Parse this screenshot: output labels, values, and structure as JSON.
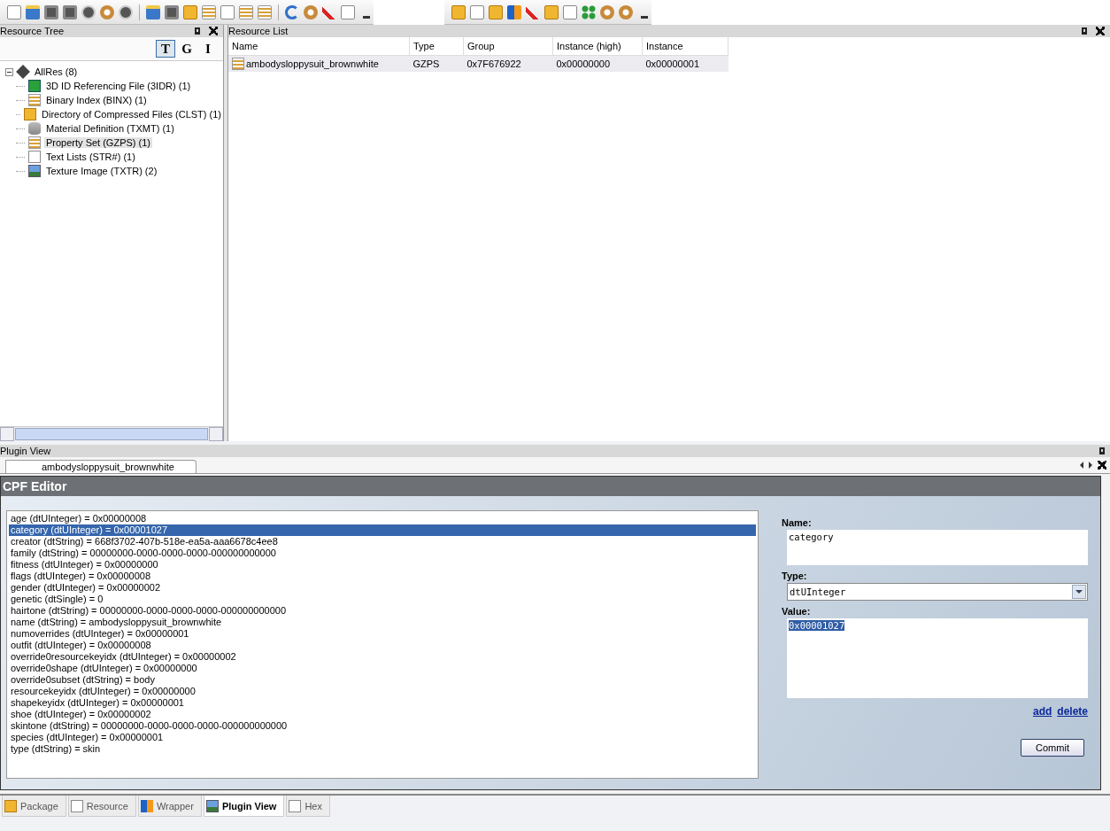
{
  "resource_tree": {
    "title": "Resource Tree",
    "view_toggles": [
      {
        "label": "T",
        "selected": true
      },
      {
        "label": "G",
        "selected": false
      },
      {
        "label": "I",
        "selected": false
      }
    ],
    "root": {
      "label": "AllRes (8)",
      "expanded": true,
      "children": [
        {
          "label": "3D ID Referencing File (3IDR) (1)",
          "selected": false
        },
        {
          "label": "Binary Index (BINX) (1)",
          "selected": false
        },
        {
          "label": "Directory of Compressed Files (CLST) (1)",
          "selected": false
        },
        {
          "label": "Material Definition (TXMT) (1)",
          "selected": false
        },
        {
          "label": "Property Set (GZPS) (1)",
          "selected": true
        },
        {
          "label": "Text Lists (STR#) (1)",
          "selected": false
        },
        {
          "label": "Texture Image (TXTR) (2)",
          "selected": false
        }
      ]
    }
  },
  "resource_list": {
    "title": "Resource List",
    "columns": [
      "Name",
      "Type",
      "Group",
      "Instance (high)",
      "Instance"
    ],
    "rows": [
      {
        "cells": [
          "ambodysloppysuit_brownwhite",
          "GZPS",
          "0x7F676922",
          "0x00000000",
          "0x00000001"
        ],
        "selected": true
      }
    ]
  },
  "plugin_view": {
    "title": "Plugin View",
    "document_tab": "ambodysloppysuit_brownwhite",
    "editor_title": "CPF Editor",
    "properties": [
      {
        "text": "age (dtUInteger) = 0x00000008",
        "selected": false
      },
      {
        "text": "category (dtUInteger) = 0x00001027",
        "selected": true
      },
      {
        "text": "creator (dtString) = 668f3702-407b-518e-ea5a-aaa6678c4ee8",
        "selected": false
      },
      {
        "text": "family (dtString) = 00000000-0000-0000-0000-000000000000",
        "selected": false
      },
      {
        "text": "fitness (dtUInteger) = 0x00000000",
        "selected": false
      },
      {
        "text": "flags (dtUInteger) = 0x00000008",
        "selected": false
      },
      {
        "text": "gender (dtUInteger) = 0x00000002",
        "selected": false
      },
      {
        "text": "genetic (dtSingle) = 0",
        "selected": false
      },
      {
        "text": "hairtone (dtString) = 00000000-0000-0000-0000-000000000000",
        "selected": false
      },
      {
        "text": "name (dtString) = ambodysloppysuit_brownwhite",
        "selected": false
      },
      {
        "text": "numoverrides (dtUInteger) = 0x00000001",
        "selected": false
      },
      {
        "text": "outfit (dtUInteger) = 0x00000008",
        "selected": false
      },
      {
        "text": "override0resourcekeyidx (dtUInteger) = 0x00000002",
        "selected": false
      },
      {
        "text": "override0shape (dtUInteger) = 0x00000000",
        "selected": false
      },
      {
        "text": "override0subset (dtString) = body",
        "selected": false
      },
      {
        "text": "resourcekeyidx (dtUInteger) = 0x00000000",
        "selected": false
      },
      {
        "text": "shapekeyidx (dtUInteger) = 0x00000001",
        "selected": false
      },
      {
        "text": "shoe (dtUInteger) = 0x00000002",
        "selected": false
      },
      {
        "text": "skintone (dtString) = 00000000-0000-0000-0000-000000000000",
        "selected": false
      },
      {
        "text": "species (dtUInteger) = 0x00000001",
        "selected": false
      },
      {
        "text": "type (dtString) = skin",
        "selected": false
      }
    ],
    "name_label": "Name:",
    "name_value": "category",
    "type_label": "Type:",
    "type_value": "dtUInteger",
    "value_label": "Value:",
    "value_value": "0x00001027",
    "links": [
      "add",
      "delete"
    ],
    "commit_button": "Commit"
  },
  "bottom_tabs": [
    {
      "label": "Package",
      "selected": false
    },
    {
      "label": "Resource",
      "selected": false
    },
    {
      "label": "Wrapper",
      "selected": false
    },
    {
      "label": "Plugin View",
      "selected": true
    },
    {
      "label": "Hex",
      "selected": false
    }
  ]
}
